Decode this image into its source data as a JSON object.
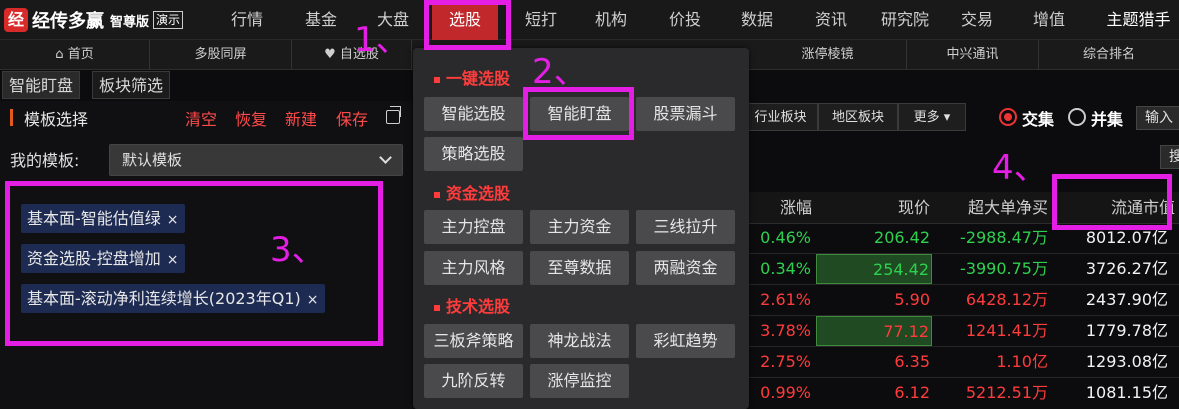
{
  "app": {
    "logo_mark": "经",
    "name": "经传多赢",
    "edition": "智尊版",
    "demo": "演示"
  },
  "topnav": [
    "行情",
    "基金",
    "大盘",
    "选股",
    "短打",
    "机构",
    "价投",
    "数据",
    "资讯",
    "研究院",
    "交易",
    "增值",
    "主题猎手"
  ],
  "subnav": {
    "home": "首页",
    "multi": "多股同屏",
    "watch": "自选股",
    "limitup": "涨停棱镜",
    "zte": "中兴通讯",
    "rank": "综合排名"
  },
  "tabs": [
    "智能盯盘",
    "板块筛选"
  ],
  "panel": {
    "title": "模板选择",
    "actions": [
      "清空",
      "恢复",
      "新建",
      "保存"
    ],
    "my_template_label": "我的模板:",
    "my_template_value": "默认模板",
    "chips": [
      "基本面-智能估值绿",
      "资金选股-控盘增加",
      "基本面-滚动净利连续增长(2023年Q1)"
    ],
    "chip_close": "×"
  },
  "dropdown": {
    "sections": [
      {
        "title": "一键选股",
        "items": [
          "智能选股",
          "智能盯盘",
          "股票漏斗",
          "策略选股"
        ]
      },
      {
        "title": "资金选股",
        "items": [
          "主力控盘",
          "主力资金",
          "三线拉升",
          "主力风格",
          "至尊数据",
          "两融资金"
        ]
      },
      {
        "title": "技术选股",
        "items": [
          "三板斧策略",
          "神龙战法",
          "彩虹趋势",
          "九阶反转",
          "涨停监控"
        ]
      }
    ]
  },
  "toolbar": {
    "industry": "行业板块",
    "region": "地区板块",
    "more": "更多 ▾",
    "intersect": "交集",
    "union": "并集",
    "input": "输入",
    "search": "搜"
  },
  "table": {
    "headers": [
      "涨幅",
      "现价",
      "超大单净买",
      "流通市值"
    ],
    "rows": [
      {
        "change": "0.46%",
        "price": "206.42",
        "net": "-2988.47万",
        "cap": "8012.07亿"
      },
      {
        "change": "0.34%",
        "price": "254.42",
        "net": "-3990.75万",
        "cap": "3726.27亿"
      },
      {
        "change": "2.61%",
        "price": "5.90",
        "net": "6428.12万",
        "cap": "2437.90亿"
      },
      {
        "change": "3.78%",
        "price": "77.12",
        "net": "1241.41万",
        "cap": "1779.78亿"
      },
      {
        "change": "2.75%",
        "price": "6.35",
        "net": "1.10亿",
        "cap": "1293.08亿"
      },
      {
        "change": "0.99%",
        "price": "6.12",
        "net": "5212.51万",
        "cap": "1081.15亿"
      }
    ]
  },
  "annotations": [
    "1、",
    "2、",
    "3、",
    "4、"
  ],
  "colors": {
    "accent": "#c0282c",
    "annotation": "#e51ee5",
    "up": "#ff3b3b",
    "down": "#2ed14f"
  }
}
